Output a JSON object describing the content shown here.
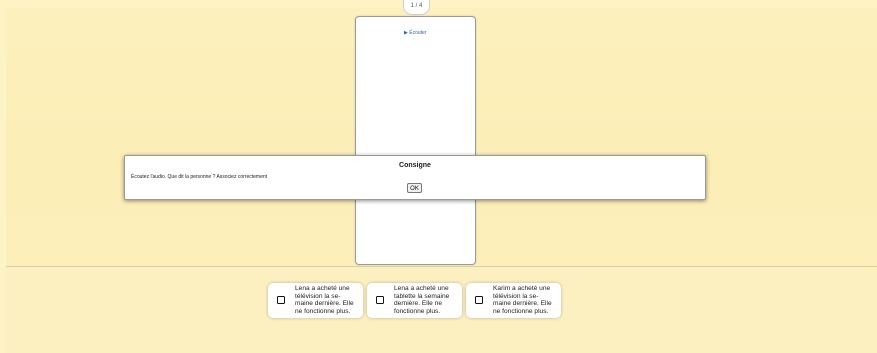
{
  "pager": {
    "text": "1 / 4"
  },
  "card": {
    "listen_label": "▶ Écouter"
  },
  "modal": {
    "title": "Consigne",
    "instruction": "Écoutez l'audio. Que dit la personne ? Associez correctement",
    "ok_label": "OK"
  },
  "options": [
    {
      "lines": [
        "Lena a acheté une",
        "télévision la se-",
        "maine dernière. Elle",
        "ne fonctionne plus."
      ]
    },
    {
      "lines": [
        "Lena a acheté une",
        "tablette la semaine",
        "dernière. Elle ne",
        "fonctionne plus."
      ]
    },
    {
      "lines": [
        "Karim a acheté une",
        "télévision la se-",
        "maine dernière. Elle",
        "ne fonctionne plus."
      ]
    }
  ],
  "colors": {
    "background": "#fdf3c4",
    "link": "#2b62c4",
    "card_border": "#9a9a9a"
  }
}
